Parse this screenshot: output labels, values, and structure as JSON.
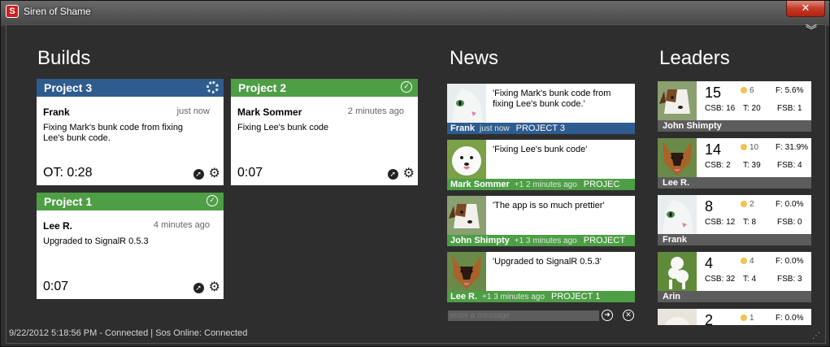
{
  "window": {
    "title": "Siren of Shame",
    "icon_letter": "S",
    "close_label": "✕"
  },
  "sections": {
    "builds": "Builds",
    "news": "News",
    "leaders": "Leaders"
  },
  "builds": [
    {
      "project": "Project 3",
      "status": "building",
      "user": "Frank",
      "time": "just now",
      "message": "Fixing Mark's bunk code from fixing Lee's bunk code.",
      "duration": "OT: 0:28",
      "color": "#2f5c8f"
    },
    {
      "project": "Project 2",
      "status": "success",
      "user": "Mark Sommer",
      "time": "2 minutes ago",
      "message": "Fixing Lee's bunk code",
      "duration": "0:07",
      "color": "#4e9e46"
    },
    {
      "project": "Project 1",
      "status": "success",
      "user": "Lee R.",
      "time": "4 minutes ago",
      "message": "Upgraded to SignalR 0.5.3",
      "duration": "0:07",
      "color": "#4e9e46"
    }
  ],
  "news": [
    {
      "text": "'Fixing Mark's bunk code from fixing Lee's bunk code.'",
      "user": "Frank",
      "meta": "just now",
      "project": "PROJECT 3",
      "color": "blue"
    },
    {
      "text": "'Fixing Lee's bunk code'",
      "user": "Mark Sommer",
      "meta": "+1  2 minutes ago",
      "project": "PROJEC",
      "color": "green"
    },
    {
      "text": "'The app is so much prettier'",
      "user": "John Shimpty",
      "meta": "+1  3 minutes ago",
      "project": "PROJECT",
      "color": "green"
    },
    {
      "text": "'Upgraded to SignalR 0.5.3'",
      "user": "Lee R.",
      "meta": "+1  3 minutes ago",
      "project": "PROJECT 1",
      "color": "green"
    }
  ],
  "message_input": {
    "placeholder": "enter a message"
  },
  "leaders": [
    {
      "rank": "15",
      "coins": "6",
      "f": "F: 5.6%",
      "csb": "CSB: 16",
      "t": "T: 20",
      "fsb": "FSB: 1",
      "name": "John Shimpty"
    },
    {
      "rank": "14",
      "coins": "10",
      "f": "F: 31.9%",
      "csb": "CSB: 2",
      "t": "T: 39",
      "fsb": "FSB: 4",
      "name": "Lee R."
    },
    {
      "rank": "8",
      "coins": "2",
      "f": "F: 0.0%",
      "csb": "CSB: 12",
      "t": "T: 8",
      "fsb": "FSB: 0",
      "name": "Frank"
    },
    {
      "rank": "4",
      "coins": "4",
      "f": "F: 0.0%",
      "csb": "CSB: 32",
      "t": "T: 4",
      "fsb": "FSB: 3",
      "name": "Arin"
    },
    {
      "rank": "2",
      "coins": "1",
      "f": "F: 0.0%",
      "csb": "",
      "t": "",
      "fsb": "",
      "name": ""
    }
  ],
  "status_bar": "9/22/2012 5:18:56 PM - Connected  |  Sos Online: Connected",
  "icons": {
    "collapse": "double-chevron-down-icon",
    "link": "arrow-link-icon",
    "gear": "gear-icon",
    "success": "check-circle-icon",
    "building": "spinner-icon",
    "send": "arrow-circle-icon",
    "clear": "x-circle-icon"
  }
}
